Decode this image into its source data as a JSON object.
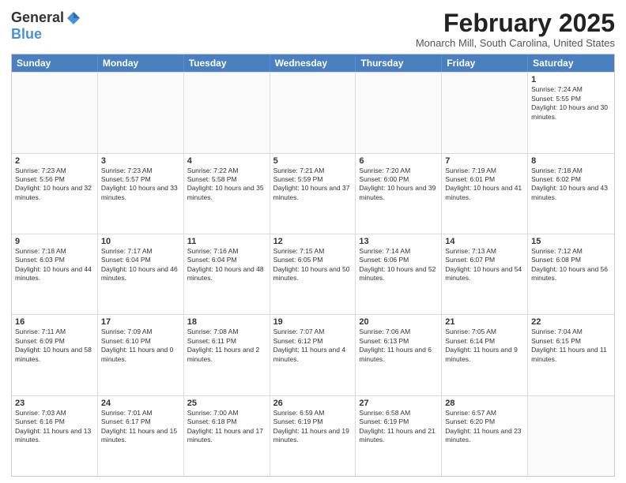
{
  "logo": {
    "general": "General",
    "blue": "Blue"
  },
  "title": "February 2025",
  "subtitle": "Monarch Mill, South Carolina, United States",
  "headers": [
    "Sunday",
    "Monday",
    "Tuesday",
    "Wednesday",
    "Thursday",
    "Friday",
    "Saturday"
  ],
  "weeks": [
    [
      {
        "day": "",
        "info": ""
      },
      {
        "day": "",
        "info": ""
      },
      {
        "day": "",
        "info": ""
      },
      {
        "day": "",
        "info": ""
      },
      {
        "day": "",
        "info": ""
      },
      {
        "day": "",
        "info": ""
      },
      {
        "day": "1",
        "info": "Sunrise: 7:24 AM\nSunset: 5:55 PM\nDaylight: 10 hours and 30 minutes."
      }
    ],
    [
      {
        "day": "2",
        "info": "Sunrise: 7:23 AM\nSunset: 5:56 PM\nDaylight: 10 hours and 32 minutes."
      },
      {
        "day": "3",
        "info": "Sunrise: 7:23 AM\nSunset: 5:57 PM\nDaylight: 10 hours and 33 minutes."
      },
      {
        "day": "4",
        "info": "Sunrise: 7:22 AM\nSunset: 5:58 PM\nDaylight: 10 hours and 35 minutes."
      },
      {
        "day": "5",
        "info": "Sunrise: 7:21 AM\nSunset: 5:59 PM\nDaylight: 10 hours and 37 minutes."
      },
      {
        "day": "6",
        "info": "Sunrise: 7:20 AM\nSunset: 6:00 PM\nDaylight: 10 hours and 39 minutes."
      },
      {
        "day": "7",
        "info": "Sunrise: 7:19 AM\nSunset: 6:01 PM\nDaylight: 10 hours and 41 minutes."
      },
      {
        "day": "8",
        "info": "Sunrise: 7:18 AM\nSunset: 6:02 PM\nDaylight: 10 hours and 43 minutes."
      }
    ],
    [
      {
        "day": "9",
        "info": "Sunrise: 7:18 AM\nSunset: 6:03 PM\nDaylight: 10 hours and 44 minutes."
      },
      {
        "day": "10",
        "info": "Sunrise: 7:17 AM\nSunset: 6:04 PM\nDaylight: 10 hours and 46 minutes."
      },
      {
        "day": "11",
        "info": "Sunrise: 7:16 AM\nSunset: 6:04 PM\nDaylight: 10 hours and 48 minutes."
      },
      {
        "day": "12",
        "info": "Sunrise: 7:15 AM\nSunset: 6:05 PM\nDaylight: 10 hours and 50 minutes."
      },
      {
        "day": "13",
        "info": "Sunrise: 7:14 AM\nSunset: 6:06 PM\nDaylight: 10 hours and 52 minutes."
      },
      {
        "day": "14",
        "info": "Sunrise: 7:13 AM\nSunset: 6:07 PM\nDaylight: 10 hours and 54 minutes."
      },
      {
        "day": "15",
        "info": "Sunrise: 7:12 AM\nSunset: 6:08 PM\nDaylight: 10 hours and 56 minutes."
      }
    ],
    [
      {
        "day": "16",
        "info": "Sunrise: 7:11 AM\nSunset: 6:09 PM\nDaylight: 10 hours and 58 minutes."
      },
      {
        "day": "17",
        "info": "Sunrise: 7:09 AM\nSunset: 6:10 PM\nDaylight: 11 hours and 0 minutes."
      },
      {
        "day": "18",
        "info": "Sunrise: 7:08 AM\nSunset: 6:11 PM\nDaylight: 11 hours and 2 minutes."
      },
      {
        "day": "19",
        "info": "Sunrise: 7:07 AM\nSunset: 6:12 PM\nDaylight: 11 hours and 4 minutes."
      },
      {
        "day": "20",
        "info": "Sunrise: 7:06 AM\nSunset: 6:13 PM\nDaylight: 11 hours and 6 minutes."
      },
      {
        "day": "21",
        "info": "Sunrise: 7:05 AM\nSunset: 6:14 PM\nDaylight: 11 hours and 9 minutes."
      },
      {
        "day": "22",
        "info": "Sunrise: 7:04 AM\nSunset: 6:15 PM\nDaylight: 11 hours and 11 minutes."
      }
    ],
    [
      {
        "day": "23",
        "info": "Sunrise: 7:03 AM\nSunset: 6:16 PM\nDaylight: 11 hours and 13 minutes."
      },
      {
        "day": "24",
        "info": "Sunrise: 7:01 AM\nSunset: 6:17 PM\nDaylight: 11 hours and 15 minutes."
      },
      {
        "day": "25",
        "info": "Sunrise: 7:00 AM\nSunset: 6:18 PM\nDaylight: 11 hours and 17 minutes."
      },
      {
        "day": "26",
        "info": "Sunrise: 6:59 AM\nSunset: 6:19 PM\nDaylight: 11 hours and 19 minutes."
      },
      {
        "day": "27",
        "info": "Sunrise: 6:58 AM\nSunset: 6:19 PM\nDaylight: 11 hours and 21 minutes."
      },
      {
        "day": "28",
        "info": "Sunrise: 6:57 AM\nSunset: 6:20 PM\nDaylight: 11 hours and 23 minutes."
      },
      {
        "day": "",
        "info": ""
      }
    ]
  ]
}
